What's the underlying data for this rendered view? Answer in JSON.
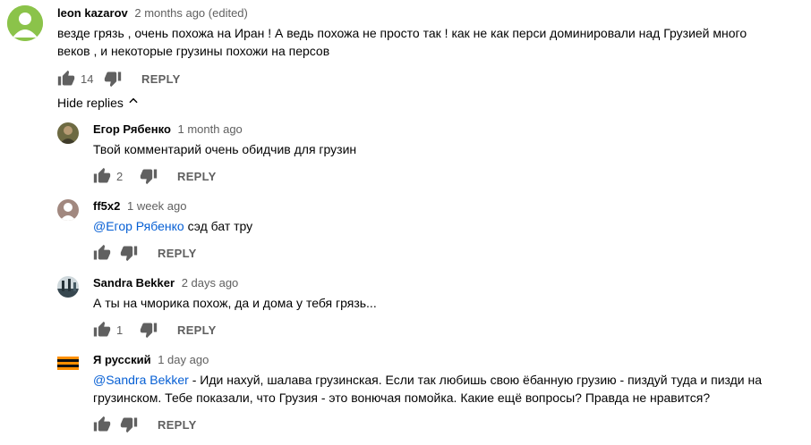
{
  "top_comment": {
    "author": "leon kazarov",
    "time": "2 months ago (edited)",
    "text_lines": [
      "везде грязь  , очень похожа на Иран ! А ведь похожа не просто так  ! как не как перси  доминировали над Грузией много",
      "веков , и некоторые грузины похожи на персов"
    ],
    "likes": "14",
    "reply_label": "REPLY"
  },
  "hide_replies_label": "Hide replies",
  "replies": [
    {
      "author": "Егор Рябенко",
      "time": "1 month ago",
      "mention": "",
      "text_lines": [
        "Твой комментарий очень обидчив для грузин"
      ],
      "likes": "2",
      "reply_label": "REPLY"
    },
    {
      "author": "ff5x2",
      "time": "1 week ago",
      "mention": "@Егор Рябенко",
      "text_lines": [
        " сэд бат тру"
      ],
      "likes": "",
      "reply_label": "REPLY"
    },
    {
      "author": "Sandra Bekker",
      "time": "2 days ago",
      "mention": "",
      "text_lines": [
        "А ты на чморика похож, да и дома у тебя грязь..."
      ],
      "likes": "1",
      "reply_label": "REPLY"
    },
    {
      "author": "Я русский",
      "time": "1 day ago",
      "mention": "@Sandra Bekker",
      "text_lines": [
        " - Иди нахуй, шалава грузинская. Если так любишь свою ёбанную грузию - пиздуй туда и пизди на",
        "грузинском. Тебе показали, что Грузия - это вонючая помойка. Какие ещё вопросы? Правда не нравится?"
      ],
      "likes": "",
      "reply_label": "REPLY"
    }
  ],
  "colors": {
    "link": "#065fd4",
    "meta": "#606060",
    "text": "#030303"
  },
  "icons": {
    "like": "thumb-up-icon",
    "dislike": "thumb-down-icon",
    "collapse": "chevron-up-icon"
  }
}
